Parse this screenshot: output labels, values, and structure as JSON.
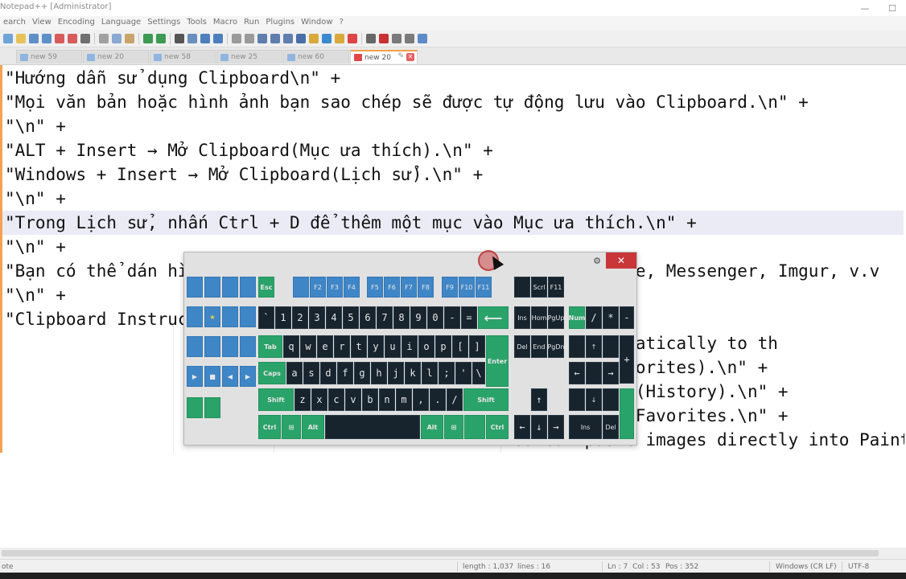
{
  "window": {
    "title": "Notepad++ [Administrator]"
  },
  "menu": [
    "earch",
    "View",
    "Encoding",
    "Language",
    "Settings",
    "Tools",
    "Macro",
    "Run",
    "Plugins",
    "Window",
    "?"
  ],
  "tabs": [
    "new 59",
    "new 20",
    "new 58",
    "new 25",
    "new 60",
    "new 20"
  ],
  "editor_lines": [
    "\"Hướng dẫn sử dụng Clipboard\\n\" +",
    "\"Mọi văn bản hoặc hình ảnh bạn sao chép sẽ được tự động lưu vào Clipboard.\\n\" +",
    "\"\\n\" +",
    "\"ALT + Insert → Mở Clipboard(Mục ưa thích).\\n\" +",
    "\"Windows + Insert → Mở Clipboard(Lịch sử).\\n\" +",
    "\"\\n\" +",
    "\"Trong Lịch sử, nhấn Ctrl + D để thêm một mục vào Mục ưa thích.\\n\" +",
    "\"\\n\" +",
    "\"Bạn có thể dán hình ảnh trực tiếp vào Paint, FastStone Capture, Messenger, Imgur, v.v",
    "\"\\n\" +",
    "\"Clipboard Instructions\\n\" +",
    "                                                 e saved automatically to th",
    "                                                  lipboard(Favorites).\\n\" +",
    "                                                  en Clipboard(History).\\n\" +",
    "                                                   an item to Favorites.\\n\" +",
    "                                                 You can paste images directly into Paint, FastStone Capture,"
  ],
  "status": {
    "length": "length : 1,037",
    "lines": "lines : 16",
    "ln": "Ln : 7",
    "col": "Col : 53",
    "pos": "Pos : 352",
    "eol": "Windows (CR LF)",
    "encoding": "UTF-8"
  },
  "keyboard": {
    "close": "✕",
    "gear": "⚙",
    "num_row": [
      "`",
      "1",
      "2",
      "3",
      "4",
      "5",
      "6",
      "7",
      "8",
      "9",
      "0",
      "-",
      "="
    ],
    "row_q": [
      "q",
      "w",
      "e",
      "r",
      "t",
      "y",
      "u",
      "i",
      "o",
      "p",
      "[",
      "]"
    ],
    "row_a": [
      "a",
      "s",
      "d",
      "f",
      "g",
      "h",
      "j",
      "k",
      "l",
      ";",
      "'",
      "\\"
    ],
    "row_z": [
      "z",
      "x",
      "c",
      "v",
      "b",
      "n",
      "m",
      ",",
      ".",
      "/"
    ],
    "fkeys": [
      "F2",
      "F3",
      "F4",
      "F5",
      "F6",
      "F7",
      "F8",
      "F9",
      "F10",
      "F11"
    ],
    "esc": "Esc",
    "tab": "Tab",
    "caps": "Caps",
    "shift": "Shift",
    "ctrl": "Ctrl",
    "alt": "Alt",
    "enter": "Enter",
    "backspace": "⟵",
    "scrl": "Scrl",
    "f11": "F11",
    "nav": [
      "Ins",
      "Hom",
      "PgUp",
      "Del",
      "End",
      "PgDn"
    ],
    "num": "Num",
    "slash": "/",
    "star": "*",
    "minus": "-",
    "plus": "+",
    "numpad_ins": "Ins",
    "numpad_del": "Del"
  }
}
